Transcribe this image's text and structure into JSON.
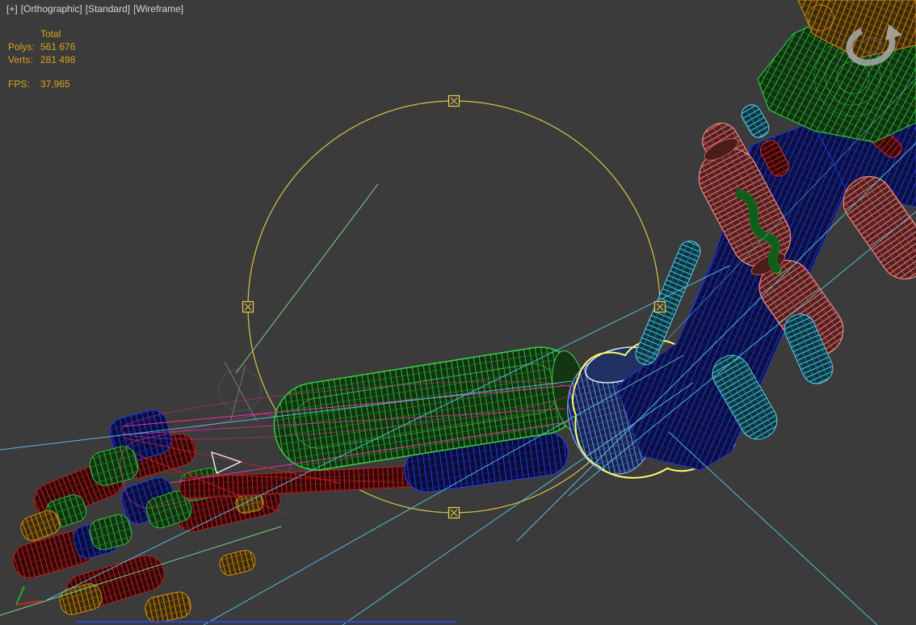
{
  "viewport": {
    "label_segments": [
      "[+]",
      "[Orthographic]",
      "[Standard]",
      "[Wireframe]"
    ],
    "stats": {
      "total_header": "Total",
      "rows": [
        {
          "label": "Polys:",
          "value": "561 676"
        },
        {
          "label": "Verts:",
          "value": "281 498"
        }
      ],
      "fps_label": "FPS:",
      "fps_value": "37,965"
    }
  },
  "icons": {
    "orbit_icon": "circular-orbit-arrow",
    "rotation_gizmo": "rotation-circle-with-square-handles",
    "axis_tripod": "world-axis-tripod"
  },
  "colors": {
    "background": "#3b3b3b",
    "stats_text": "#daa41d",
    "viewport_label_text": "#d6d6d6",
    "gizmo_yellow": "#e6d24a",
    "selection_yellow": "#ffff66",
    "model_green": "#2fb53c",
    "model_blue": "#2a3ae0",
    "model_red": "#c42626",
    "model_salmon": "#ef8a8a",
    "model_cyan": "#54cae6",
    "model_orange": "#cf8c1c",
    "bone_magenta": "#e8359a",
    "guide_cyan": "#58c8e8"
  }
}
